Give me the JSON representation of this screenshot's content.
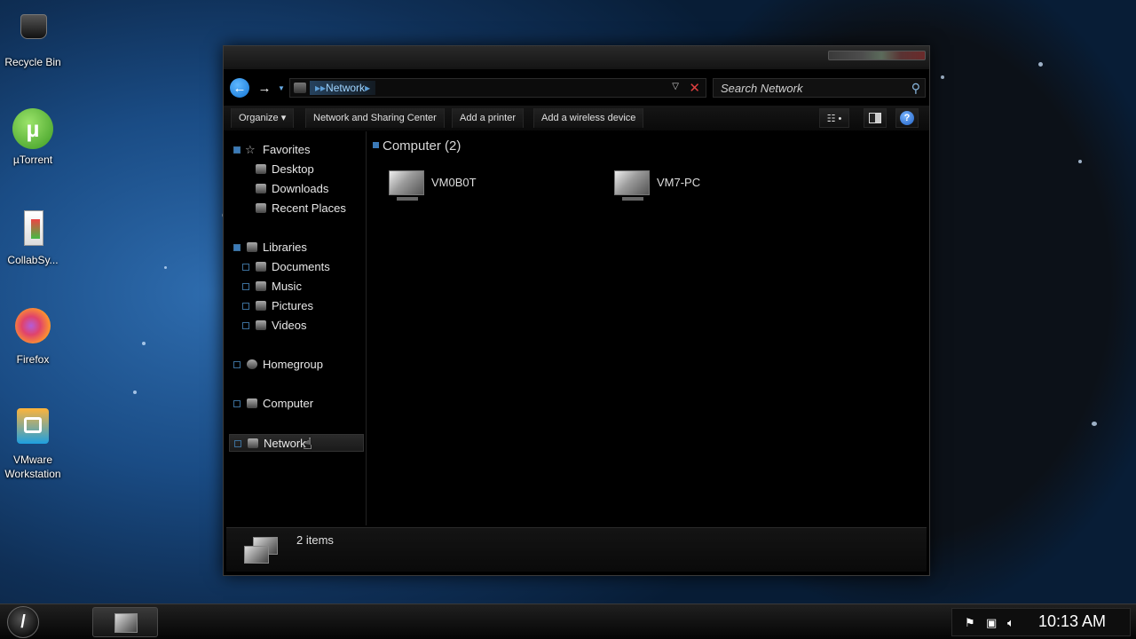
{
  "desktop": {
    "icons": [
      {
        "label": "Recycle Bin",
        "icon": "recycle-bin-icon"
      },
      {
        "label": "µTorrent",
        "icon": "utorrent-icon"
      },
      {
        "label": "CollabSy...",
        "icon": "collabsync-icon"
      },
      {
        "label": "Firefox",
        "icon": "firefox-icon"
      },
      {
        "label": "VMware Workstation",
        "icon": "vmware-icon"
      }
    ]
  },
  "window": {
    "address": {
      "crumb": "Network"
    },
    "search": {
      "placeholder": "Search Network"
    },
    "toolbar": {
      "organize": "Organize",
      "network_center": "Network and Sharing Center",
      "add_printer": "Add a printer",
      "add_wireless": "Add a wireless device"
    },
    "navpane": {
      "favorites": "Favorites",
      "desktop": "Desktop",
      "downloads": "Downloads",
      "recent": "Recent Places",
      "libraries": "Libraries",
      "documents": "Documents",
      "music": "Music",
      "pictures": "Pictures",
      "videos": "Videos",
      "homegroup": "Homegroup",
      "computer": "Computer",
      "network": "Network"
    },
    "content": {
      "group_header": "Computer (2)",
      "items": [
        {
          "label": "VM0B0T"
        },
        {
          "label": "VM7-PC"
        }
      ]
    },
    "status": {
      "text": "2 items"
    }
  },
  "taskbar": {
    "clock": "10:13 AM"
  },
  "colors": {
    "accent": "#1476d6",
    "crumb": "#9fd4ff",
    "close": "#e04040"
  }
}
